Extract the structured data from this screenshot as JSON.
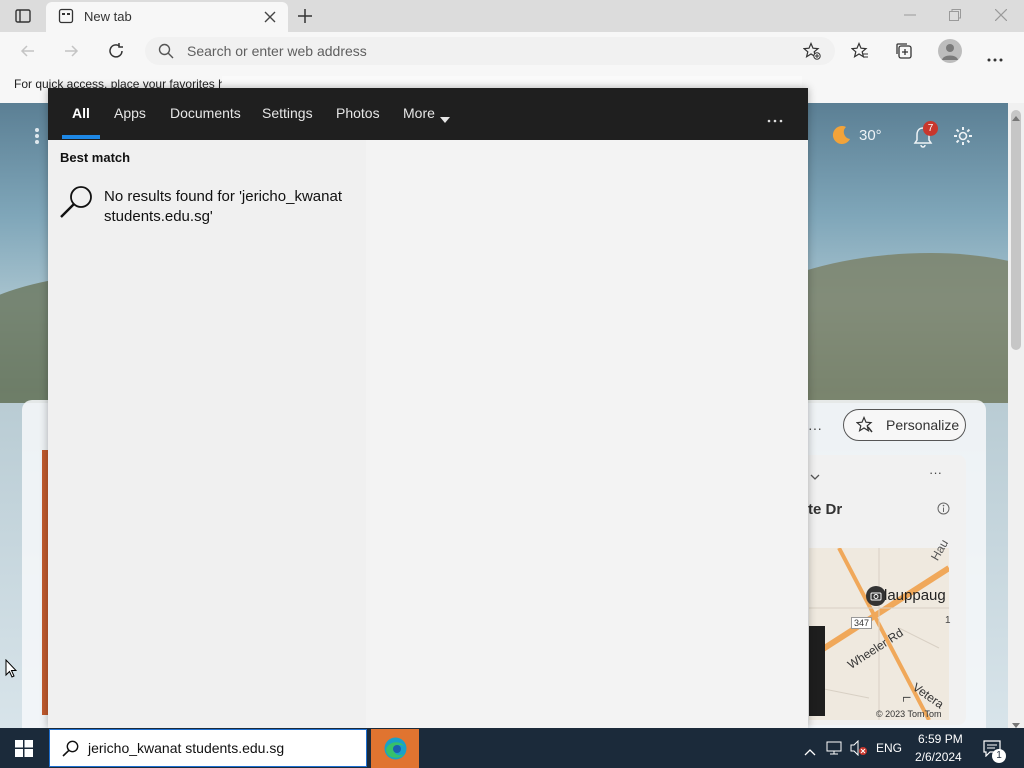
{
  "browser": {
    "tab_title": "New tab",
    "address_placeholder": "Search or enter web address",
    "favorites_hint": "For quick access, place your favorites h"
  },
  "newtab": {
    "weather": "30°",
    "notification_count": "7",
    "personalize_label": "Personalize",
    "widget_title": "te Dr",
    "map_labels": [
      "Hau",
      "lauppaug",
      "347",
      "Wheeler Rd",
      "Vetera",
      "L",
      "1"
    ],
    "map_credit": "© 2023 TomTom"
  },
  "search_panel": {
    "tabs": [
      "All",
      "Apps",
      "Documents",
      "Settings",
      "Photos",
      "More"
    ],
    "active_tab": "All",
    "section_title": "Best match",
    "no_result_line1": "No results found for 'jericho_kwanat",
    "no_result_line2": "students.edu.sg'"
  },
  "taskbar": {
    "search_query": "jericho_kwanat students.edu.sg",
    "language": "ENG",
    "time": "6:59 PM",
    "date": "2/6/2024",
    "notification_badge": "1"
  },
  "colors": {
    "search_nav_bg": "#1f1f1f",
    "search_active_underline": "#1e88e5",
    "taskbar_bg": "#1b2a3a",
    "edge_button_bg": "#e07430"
  }
}
